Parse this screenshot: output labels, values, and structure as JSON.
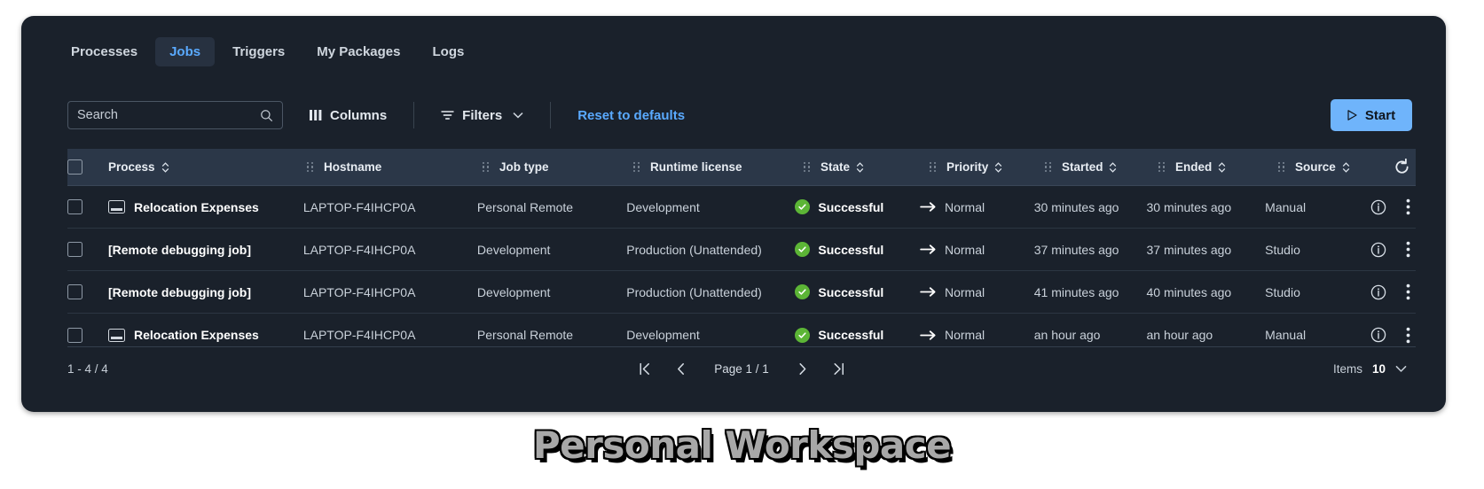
{
  "caption": "Personal Workspace",
  "tabs": [
    {
      "label": "Processes",
      "active": false
    },
    {
      "label": "Jobs",
      "active": true
    },
    {
      "label": "Triggers",
      "active": false
    },
    {
      "label": "My Packages",
      "active": false
    },
    {
      "label": "Logs",
      "active": false
    }
  ],
  "toolbar": {
    "search_placeholder": "Search",
    "search_value": "",
    "columns_label": "Columns",
    "filters_label": "Filters",
    "reset_label": "Reset to defaults",
    "start_label": "Start"
  },
  "table": {
    "columns": [
      {
        "key": "process",
        "label": "Process",
        "sortable": true,
        "draggable": false
      },
      {
        "key": "hostname",
        "label": "Hostname",
        "sortable": false,
        "draggable": true
      },
      {
        "key": "job_type",
        "label": "Job type",
        "sortable": false,
        "draggable": true
      },
      {
        "key": "runtime_license",
        "label": "Runtime license",
        "sortable": false,
        "draggable": true
      },
      {
        "key": "state",
        "label": "State",
        "sortable": true,
        "draggable": true
      },
      {
        "key": "priority",
        "label": "Priority",
        "sortable": true,
        "draggable": true
      },
      {
        "key": "started",
        "label": "Started",
        "sortable": true,
        "draggable": true
      },
      {
        "key": "ended",
        "label": "Ended",
        "sortable": true,
        "draggable": true
      },
      {
        "key": "source",
        "label": "Source",
        "sortable": true,
        "draggable": true
      }
    ],
    "rows": [
      {
        "process": "Relocation Expenses",
        "has_process_icon": true,
        "hostname": "LAPTOP-F4IHCP0A",
        "job_type": "Personal Remote",
        "runtime_license": "Development",
        "state": "Successful",
        "priority": "Normal",
        "started": "30 minutes ago",
        "ended": "30 minutes ago",
        "source": "Manual"
      },
      {
        "process": "[Remote debugging job]",
        "has_process_icon": false,
        "hostname": "LAPTOP-F4IHCP0A",
        "job_type": "Development",
        "runtime_license": "Production (Unattended)",
        "state": "Successful",
        "priority": "Normal",
        "started": "37 minutes ago",
        "ended": "37 minutes ago",
        "source": "Studio"
      },
      {
        "process": "[Remote debugging job]",
        "has_process_icon": false,
        "hostname": "LAPTOP-F4IHCP0A",
        "job_type": "Development",
        "runtime_license": "Production (Unattended)",
        "state": "Successful",
        "priority": "Normal",
        "started": "41 minutes ago",
        "ended": "40 minutes ago",
        "source": "Studio"
      },
      {
        "process": "Relocation Expenses",
        "has_process_icon": true,
        "hostname": "LAPTOP-F4IHCP0A",
        "job_type": "Personal Remote",
        "runtime_license": "Development",
        "state": "Successful",
        "priority": "Normal",
        "started": "an hour ago",
        "ended": "an hour ago",
        "source": "Manual"
      }
    ]
  },
  "footer": {
    "range": "1 - 4 / 4",
    "page_label": "Page 1 / 1",
    "items_label": "Items",
    "items_value": "10"
  },
  "colors": {
    "card_bg": "#1a212b",
    "header_bg": "#2b3748",
    "accent_blue": "#5aaaff",
    "start_blue": "#6fb4fb",
    "success_green": "#5cb536"
  },
  "icons": {
    "search": "search-icon",
    "columns": "columns-icon",
    "filters": "filter-icon",
    "filters_chevron": "chevron-down-icon",
    "start": "play-icon",
    "refresh": "refresh-icon",
    "state": "check-circle-icon",
    "priority": "arrow-right-icon",
    "info": "info-icon",
    "more": "more-vertical-icon",
    "first_page": "first-page-icon",
    "prev_page": "prev-page-icon",
    "next_page": "next-page-icon",
    "last_page": "last-page-icon",
    "items_chevron": "chevron-down-icon",
    "process": "monitor-icon"
  }
}
